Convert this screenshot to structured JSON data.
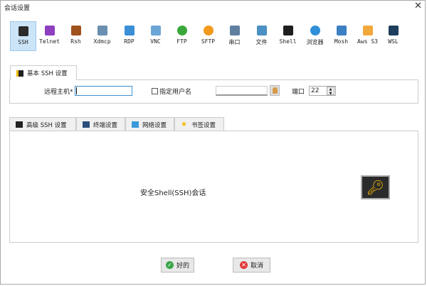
{
  "window": {
    "title": "会话设置",
    "close_icon": "close-icon"
  },
  "protocols": [
    {
      "label": "SSH",
      "icon": "key-icon",
      "color": "#2b2b2b",
      "selected": true
    },
    {
      "label": "Telnet",
      "icon": "telnet-icon",
      "color": "#8e3fbf"
    },
    {
      "label": "Rsh",
      "icon": "rsh-icon",
      "color": "#a0521d"
    },
    {
      "label": "Xdmcp",
      "icon": "xdmcp-icon",
      "color": "#6a8fb0"
    },
    {
      "label": "RDP",
      "icon": "rdp-icon",
      "color": "#3a8fd6"
    },
    {
      "label": "VNC",
      "icon": "vnc-icon",
      "color": "#6ba5d8"
    },
    {
      "label": "FTP",
      "icon": "ftp-globe-icon",
      "color": "#3aa83a"
    },
    {
      "label": "SFTP",
      "icon": "sftp-globe-icon",
      "color": "#f29a1d"
    },
    {
      "label": "串口",
      "icon": "serial-plug-icon",
      "color": "#5f7fa0"
    },
    {
      "label": "文件",
      "icon": "file-monitor-icon",
      "color": "#4a90c2"
    },
    {
      "label": "Shell",
      "icon": "shell-terminal-icon",
      "color": "#1e1e1e"
    },
    {
      "label": "浏览器",
      "icon": "browser-globe-icon",
      "color": "#2f8fd8"
    },
    {
      "label": "Mosh",
      "icon": "mosh-satellite-icon",
      "color": "#3d7fc4"
    },
    {
      "label": "Aws S3",
      "icon": "aws-s3-icon",
      "color": "#f2a93b"
    },
    {
      "label": "WSL",
      "icon": "wsl-windows-icon",
      "color": "#1f3d5c"
    }
  ],
  "basic": {
    "tab": "基本 SSH 设置",
    "remote_host_label": "远程主机*",
    "remote_host_value": "",
    "specify_user_label": "指定用户名",
    "specify_user_checked": false,
    "username_value": "",
    "port_label": "端口",
    "port_value": "22"
  },
  "advanced_tabs": [
    {
      "label": "高级 SSH 设置",
      "icon": "key-icon",
      "active": true
    },
    {
      "label": "终端设置",
      "icon": "terminal-icon"
    },
    {
      "label": "网络设置",
      "icon": "network-icon"
    },
    {
      "label": "书签设置",
      "icon": "star-icon"
    }
  ],
  "content": {
    "description": "安全Shell(SSH)会话"
  },
  "buttons": {
    "ok": "好的",
    "cancel": "取消"
  }
}
